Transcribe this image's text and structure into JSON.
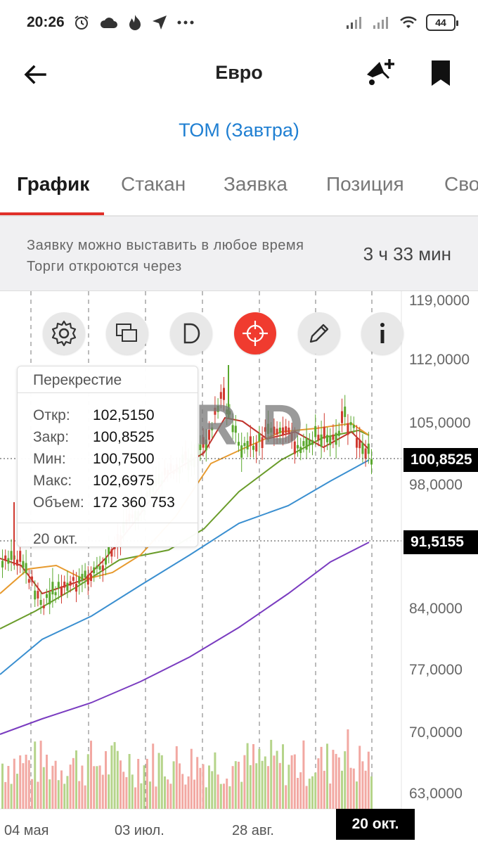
{
  "status": {
    "time": "20:26",
    "battery": "44",
    "left_icons": [
      "alarm-icon",
      "cloud-icon",
      "flame-icon",
      "location-arrow-icon",
      "more-dots-icon"
    ],
    "right_icons": [
      "signal-icon",
      "signal-icon",
      "wifi-icon",
      "battery-icon"
    ]
  },
  "header": {
    "title": "Евро",
    "back_icon": "arrow-left-icon",
    "alert_icon": "bell-plus-icon",
    "bookmark_icon": "bookmark-icon"
  },
  "subtitle": "ТОМ (Завтра)",
  "tabs": [
    {
      "label": "График",
      "active": true
    },
    {
      "label": "Стакан",
      "active": false
    },
    {
      "label": "Заявка",
      "active": false
    },
    {
      "label": "Позиция",
      "active": false
    },
    {
      "label": "Сво",
      "active": false
    }
  ],
  "notice": {
    "text": "Заявку можно выставить в любое время Торги откроются через",
    "timer": "3 ч 33 мин"
  },
  "toolbar": [
    {
      "icon": "gear-icon",
      "active": false
    },
    {
      "icon": "layers-icon",
      "active": false
    },
    {
      "icon": "d-letter-icon",
      "active": false
    },
    {
      "icon": "crosshair-icon",
      "active": true
    },
    {
      "icon": "pencil-icon",
      "active": false
    },
    {
      "icon": "info-icon",
      "active": false
    }
  ],
  "watermark": "R D",
  "crosshair": {
    "title": "Перекрестие",
    "rows": [
      {
        "label": "Откр:",
        "value": "102,5150"
      },
      {
        "label": "Закр:",
        "value": "100,8525"
      },
      {
        "label": "Мин:",
        "value": "100,7500"
      },
      {
        "label": "Макс:",
        "value": "102,6975"
      },
      {
        "label": "Объем:",
        "value": "172 360 753"
      }
    ],
    "date": "20 окт."
  },
  "axis": {
    "y_ticks": [
      "119,0000",
      "112,0000",
      "105,0000",
      "98,0000",
      "84,0000",
      "77,0000",
      "70,0000",
      "63,0000"
    ],
    "price_tags": [
      "100,8525",
      "91,5155"
    ],
    "x_ticks": [
      "04 мая",
      "03 июл.",
      "28 авг."
    ],
    "x_tag": "20 окт."
  },
  "colors": {
    "accent": "#e0302a",
    "link": "#1f7fd2",
    "ma_red": "#c0332c",
    "ma_orange": "#e79a2e",
    "ma_green": "#6a9c2a",
    "ma_blue": "#3a8fd0",
    "ma_purple": "#7a3cc0",
    "candle_up": "#5aa82e",
    "candle_down": "#d03a30"
  }
}
